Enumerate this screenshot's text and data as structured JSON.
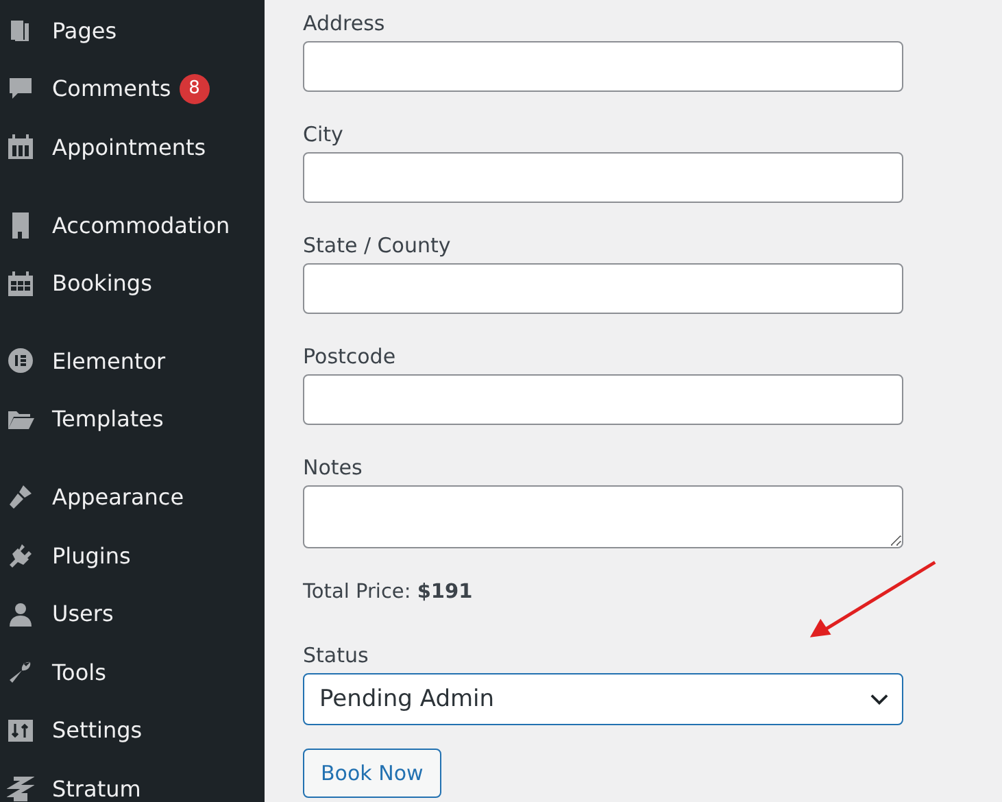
{
  "sidebar": {
    "groups": [
      {
        "items": [
          {
            "label": "Pages"
          },
          {
            "label": "Comments",
            "badge": "8"
          },
          {
            "label": "Appointments"
          }
        ]
      },
      {
        "items": [
          {
            "label": "Accommodation"
          },
          {
            "label": "Bookings"
          }
        ]
      },
      {
        "items": [
          {
            "label": "Elementor"
          },
          {
            "label": "Templates"
          }
        ]
      },
      {
        "items": [
          {
            "label": "Appearance"
          },
          {
            "label": "Plugins"
          },
          {
            "label": "Users"
          },
          {
            "label": "Tools"
          },
          {
            "label": "Settings"
          },
          {
            "label": "Stratum"
          }
        ]
      }
    ]
  },
  "form": {
    "fields": [
      {
        "label": "Address",
        "kind": "text"
      },
      {
        "label": "City",
        "kind": "text"
      },
      {
        "label": "State / County",
        "kind": "text"
      },
      {
        "label": "Postcode",
        "kind": "text"
      },
      {
        "label": "Notes",
        "kind": "textarea"
      }
    ],
    "total": "Total Price: **$191**",
    "status": {
      "label": "Status",
      "value": "Pending Admin"
    },
    "button": "Book Now"
  }
}
